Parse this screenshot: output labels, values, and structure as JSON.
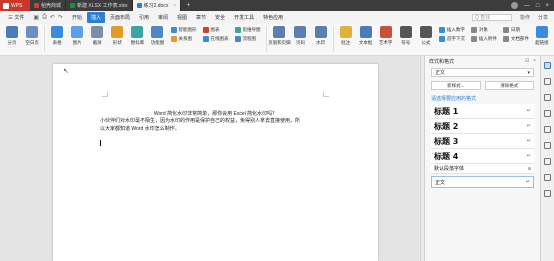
{
  "titlebar": {
    "app": "WPS",
    "tabs": [
      {
        "label": "稻壳商城",
        "color": "#d0402f"
      },
      {
        "label": "新建 XLSX 工作表.xlsx",
        "color": "#1e8e3e"
      },
      {
        "label": "练习2.docx",
        "color": "#2b7fd6"
      }
    ],
    "add_tab": "+"
  },
  "menubar": {
    "file": "三 文件",
    "items": [
      "开始",
      "插入",
      "页面布局",
      "引用",
      "审阅",
      "视图",
      "章节",
      "安全",
      "开发工具",
      "特色应用"
    ],
    "active_index": 1,
    "search_placeholder": "Q 查找",
    "right": [
      "协作",
      "分享"
    ]
  },
  "ribbon": {
    "big": [
      {
        "label": "分页",
        "color": "#4a7bb7"
      },
      {
        "label": "空白页",
        "color": "#6b8fc3"
      },
      {
        "label": "表格",
        "color": "#3a8dde"
      },
      {
        "label": "图片",
        "color": "#5aa0e6"
      },
      {
        "label": "截屏",
        "color": "#7b8ea6"
      },
      {
        "label": "形状",
        "color": "#e39b2e"
      },
      {
        "label": "图标库",
        "color": "#3aa6a0"
      },
      {
        "label": "功能图",
        "color": "#4d87c9"
      }
    ],
    "small1": [
      "智能图形",
      "关系图"
    ],
    "small2": [
      "图表",
      "在线图表"
    ],
    "small3": [
      "思维导图",
      "流程图"
    ],
    "big2": [
      {
        "label": "页眉和页脚",
        "color": "#5b7fae"
      },
      {
        "label": "页码",
        "color": "#5b7fae"
      },
      {
        "label": "水印",
        "color": "#5b7fae"
      },
      {
        "label": "批注",
        "color": "#e0b23a"
      },
      {
        "label": "文本框",
        "color": "#4a7bb7"
      },
      {
        "label": "艺术字",
        "color": "#c94f3a"
      },
      {
        "label": "符号",
        "color": "#555555"
      },
      {
        "label": "公式",
        "color": "#555555"
      }
    ],
    "small4": [
      "插入数字",
      "首字下沉"
    ],
    "small5": [
      "对象",
      "插入附件"
    ],
    "small6": [
      "日期",
      "文档部件"
    ],
    "last": {
      "label": "超链接",
      "color": "#3a8dde"
    }
  },
  "document": {
    "title": "Word 简化水印非常简单，那你会用 Excel 简化水印吗？",
    "lines": [
      "小伙伴们对水印毫不陌生，因为水印的作用是保护自己的权益，免得别人拿去直接使用，所",
      "以大家都知道 Word 水印怎么制作。"
    ]
  },
  "pane": {
    "title": "样式和格式",
    "current_style": "正文",
    "btn_new": "新样式...",
    "btn_clear": "清除格式",
    "subtitle": "请选择要应用的格式",
    "styles": [
      {
        "label": "标题 1",
        "mark": "↵"
      },
      {
        "label": "标题 2",
        "mark": "↵"
      },
      {
        "label": "标题 3",
        "mark": "↵"
      },
      {
        "label": "标题 4",
        "mark": "↵"
      }
    ],
    "default_font": "默认段落字体",
    "default_font_mark": "a",
    "normal": "正文",
    "normal_mark": "↵"
  }
}
